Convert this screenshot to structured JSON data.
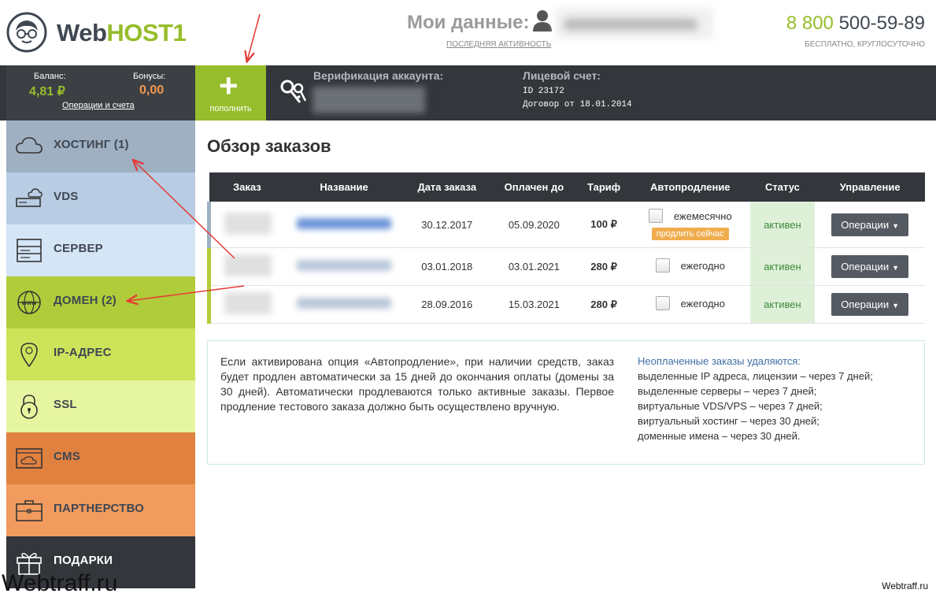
{
  "header": {
    "logo_part1": "Web",
    "logo_part2": "HOST1",
    "my_data_label": "Мои данные:",
    "last_activity": "ПОСЛЕДНЯЯ АКТИВНОСТЬ",
    "phone_prefix": "8 800",
    "phone_number": "500-59-89",
    "phone_note": "БЕСПЛАТНО, КРУГЛОСУТОЧНО"
  },
  "account_bar": {
    "balance_label": "Баланс:",
    "balance_value": "4,81 ₽",
    "bonus_label": "Бонусы:",
    "bonus_value": "0,00",
    "operations_link": "Операции и счета",
    "topup_label": "пополнить",
    "verification_label": "Верификация аккаунта:",
    "account_label": "Лицевой счет:",
    "account_id": "ID 23172",
    "contract": "Договор от 18.01.2014"
  },
  "sidebar": {
    "items": [
      {
        "label": "ХОСТИНГ (1)",
        "icon": "cloud-icon"
      },
      {
        "label": "VDS",
        "icon": "cloud-server-icon"
      },
      {
        "label": "СЕРВЕР",
        "icon": "server-icon"
      },
      {
        "label": "ДОМЕН (2)",
        "icon": "globe-www-icon"
      },
      {
        "label": "IP-АДРЕС",
        "icon": "location-pin-icon"
      },
      {
        "label": "SSL",
        "icon": "lock-icon"
      },
      {
        "label": "CMS",
        "icon": "cms-window-icon"
      },
      {
        "label": "ПАРТНЕРСТВО",
        "icon": "briefcase-icon"
      },
      {
        "label": "ПОДАРКИ",
        "icon": "gift-icon"
      }
    ]
  },
  "main": {
    "title": "Обзор заказов",
    "columns": [
      "Заказ",
      "Название",
      "Дата заказа",
      "Оплачен до",
      "Тариф",
      "Автопродление",
      "Статус",
      "Управление"
    ],
    "rows": [
      {
        "order_date": "30.12.2017",
        "paid_until": "05.09.2020",
        "tariff": "100 ₽",
        "autorenew": "ежемесячно",
        "renew_now": "продлить сейчас",
        "status": "активен",
        "action": "Операции"
      },
      {
        "order_date": "03.01.2018",
        "paid_until": "03.01.2021",
        "tariff": "280 ₽",
        "autorenew": "ежегодно",
        "status": "активен",
        "action": "Операции"
      },
      {
        "order_date": "28.09.2016",
        "paid_until": "15.03.2021",
        "tariff": "280 ₽",
        "autorenew": "ежегодно",
        "status": "активен",
        "action": "Операции"
      }
    ],
    "info_left": "Если активирована опция «Автопродление», при наличии средств, заказ будет продлен автоматически за 15 дней до окончания оплаты (домены за 30 дней). Автоматически продлеваются только активные заказы. Первое продление тестового заказа должно быть осуществлено вручную.",
    "info_right": {
      "heading": "Неоплаченные заказы удаляются:",
      "lines": [
        "выделенные IP адреса, лицензии – через 7 дней;",
        "выделенные серверы – через 7 дней;",
        "виртуальные VDS/VPS – через 7 дней;",
        "виртуальный хостинг – через 30 дней;",
        "доменные имена – через 30 дней."
      ]
    }
  },
  "watermark": {
    "left": "Webtraff.ru",
    "right": "Webtraff.ru"
  },
  "colors": {
    "brand_green": "#96bd2b",
    "dark_bar": "#33363b",
    "bonus_orange": "#f4974d",
    "status_bg": "#dff0d8",
    "annotation_arrow": "#e53935"
  }
}
